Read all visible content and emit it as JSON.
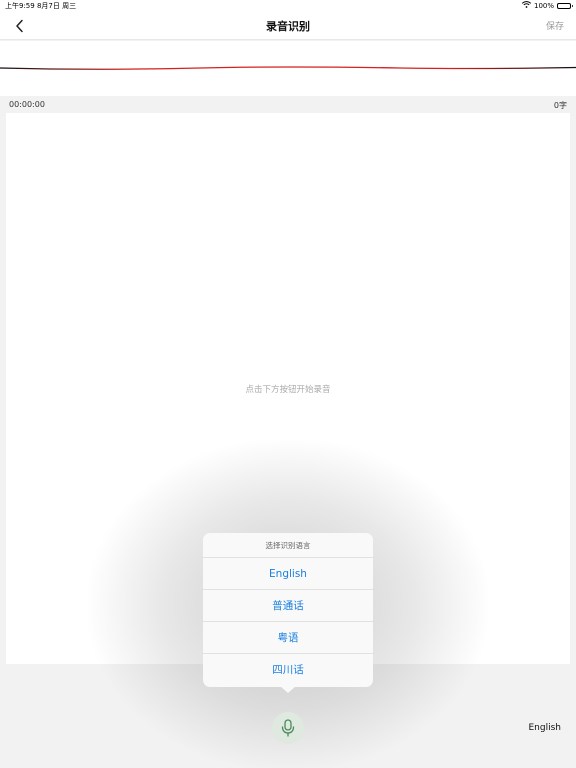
{
  "status_bar": {
    "time_date": "上午9:59   8月7日 周三",
    "battery": "100%",
    "icons": [
      "wifi-icon",
      "battery-icon"
    ]
  },
  "nav": {
    "back_icon": "chevron-left-icon",
    "title": "录音识别",
    "save_label": "保存"
  },
  "waveform": {
    "colors": {
      "left": "#111111",
      "center": "#d42020",
      "right": "#111111"
    }
  },
  "info": {
    "duration": "00:00:00",
    "char_count": "0字"
  },
  "content": {
    "placeholder": "点击下方按钮开始录音"
  },
  "language_menu": {
    "title": "选择识别语言",
    "options": [
      "English",
      "普通话",
      "粤语",
      "四川话"
    ],
    "accent_color": "#1a7fe0"
  },
  "bottom": {
    "mic_icon": "microphone-icon",
    "selected_language": "English"
  }
}
